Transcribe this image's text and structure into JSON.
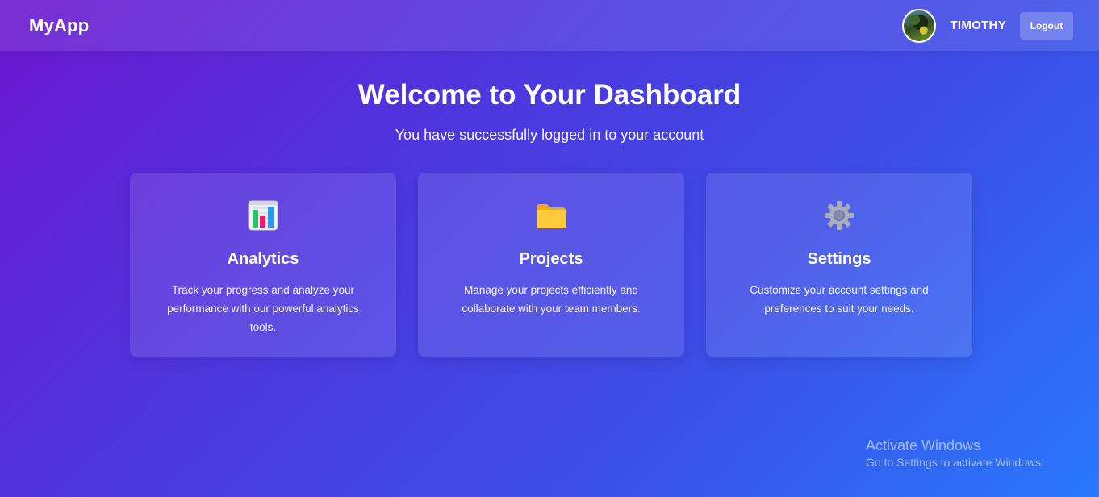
{
  "navbar": {
    "brand": "MyApp",
    "username": "TIMOTHY",
    "logout_label": "Logout"
  },
  "hero": {
    "title": "Welcome to Your Dashboard",
    "subtitle": "You have successfully logged in to your account"
  },
  "cards": [
    {
      "icon": "bar-chart-icon",
      "title": "Analytics",
      "description": "Track your progress and analyze your performance with our powerful analytics tools."
    },
    {
      "icon": "folder-icon",
      "title": "Projects",
      "description": "Manage your projects efficiently and collaborate with your team members."
    },
    {
      "icon": "gear-icon",
      "title": "Settings",
      "description": "Customize your account settings and preferences to suit your needs."
    }
  ],
  "watermark": {
    "title": "Activate Windows",
    "subtitle": "Go to Settings to activate Windows."
  },
  "colors": {
    "gradient_start": "#6b16cf",
    "gradient_end": "#2978fb",
    "text": "#ffffff"
  }
}
